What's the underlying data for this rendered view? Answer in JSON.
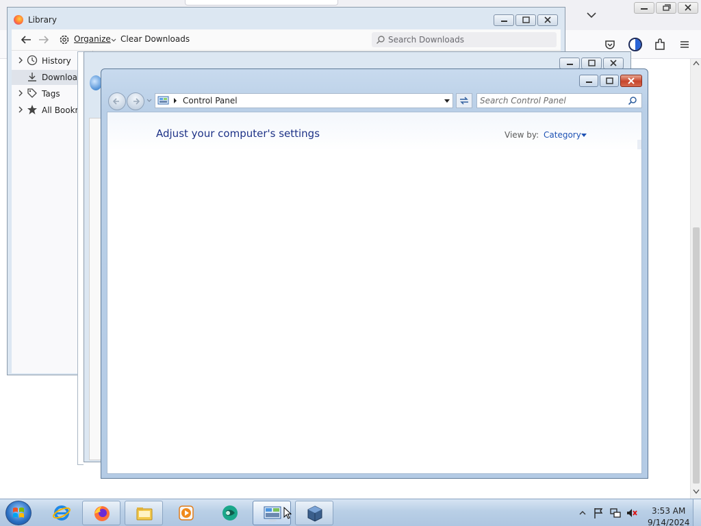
{
  "firefox": {
    "toolbar_icons": [
      "pocket-icon",
      "vpn-shield-icon",
      "extensions-icon",
      "menu-icon"
    ]
  },
  "library": {
    "title": "Library",
    "toolbar": {
      "organize_label": "Organize",
      "clear_downloads_label": "Clear Downloads",
      "search_placeholder": "Search Downloads"
    },
    "tree": [
      {
        "label": "History",
        "icon": "clock-icon",
        "expandable": true
      },
      {
        "label": "Downloads",
        "icon": "download-icon",
        "expandable": false,
        "selected": true
      },
      {
        "label": "Tags",
        "icon": "tag-icon",
        "expandable": true
      },
      {
        "label": "All Bookma",
        "icon": "star-icon",
        "expandable": true
      }
    ]
  },
  "control_panel": {
    "address": "Control Panel",
    "search_placeholder": "Search Control Panel",
    "heading": "Adjust your computer's settings",
    "view_by_label": "View by:",
    "view_by_value": "Category"
  },
  "taskbar": {
    "buttons": [
      {
        "name": "internet-explorer",
        "state": "pinned"
      },
      {
        "name": "firefox",
        "state": "open"
      },
      {
        "name": "file-explorer",
        "state": "open"
      },
      {
        "name": "media-player",
        "state": "pinned"
      },
      {
        "name": "app-teal",
        "state": "pinned"
      },
      {
        "name": "control-panel",
        "state": "active"
      },
      {
        "name": "virtualbox",
        "state": "open"
      }
    ],
    "clock": {
      "time": "3:53 AM",
      "date": "9/14/2024"
    }
  },
  "colors": {
    "aero_frame": "#b9cfe7",
    "link_blue": "#1e52b4",
    "heading_blue": "#1e3287",
    "close_red": "#c7452c"
  }
}
